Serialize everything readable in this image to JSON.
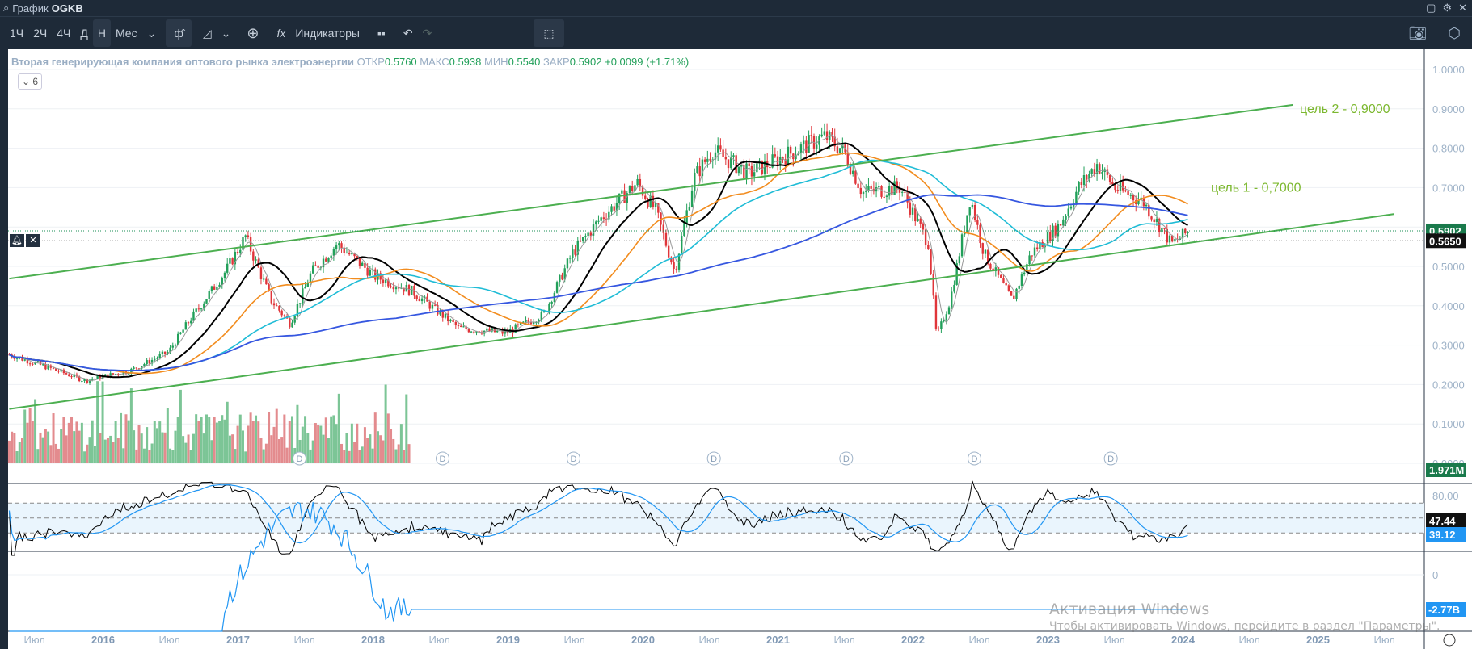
{
  "window": {
    "title_prefix": "График",
    "symbol": "OGKB"
  },
  "toolbar": {
    "intervals": [
      "1Ч",
      "2Ч",
      "4Ч",
      "Д",
      "Н",
      "Мес"
    ],
    "active_interval": "Н",
    "indicators_label": "Индикаторы"
  },
  "legend": {
    "name": "Вторая генерирующая компания оптового рынка электроэнергии",
    "open_label": "ОТКР",
    "open": "0.5760",
    "high_label": "МАКС",
    "high": "0.5938",
    "low_label": "МИН",
    "low": "0.5540",
    "close_label": "ЗАКР",
    "close": "0.5902",
    "change": "+0.0099 (+1.71%)",
    "collapse": "6"
  },
  "colors": {
    "up": "#22a05a",
    "down": "#e0353a",
    "trend": "#4caf50",
    "ma_fast": "#999999",
    "ma20": "#000000",
    "ma50": "#f28c1e",
    "ma100": "#1fbcd6",
    "ma200": "#3657e0",
    "rsi": "#000000",
    "rsi_ma": "#2196f3"
  },
  "annotations": {
    "target2": "цель 2 - 0,9000",
    "target1": "цель 1 - 0,7000"
  },
  "price_axis": {
    "ticks": [
      "1.0000",
      "0.9000",
      "0.8000",
      "0.7000",
      "0.6000",
      "0.5000",
      "0.4000",
      "0.3000",
      "0.2000",
      "0.1000",
      "0.0000"
    ],
    "last_price": "0.5902",
    "alert_price": "0.5650",
    "volume_label": "1.971M"
  },
  "rsi_axis": {
    "tick": "80.00",
    "rsi_value": "47.44",
    "rsi_ma_value": "39.12"
  },
  "lower_axis": {
    "tick": "0",
    "value": "-2.77B"
  },
  "time_axis": [
    "Июл",
    "2016",
    "Июл",
    "2017",
    "Июл",
    "2018",
    "Июл",
    "2019",
    "Июл",
    "2020",
    "Июл",
    "2021",
    "Июл",
    "2022",
    "Июл",
    "2023",
    "Июл",
    "2024",
    "Июл",
    "2025",
    "Июл"
  ],
  "price_keypoints": [
    [
      2015.32,
      0.276
    ],
    [
      2015.67,
      0.236
    ],
    [
      2015.88,
      0.21
    ],
    [
      2016.22,
      0.236
    ],
    [
      2016.5,
      0.283
    ],
    [
      2016.64,
      0.355
    ],
    [
      2016.92,
      0.486
    ],
    [
      2017.07,
      0.576
    ],
    [
      2017.26,
      0.414
    ],
    [
      2017.4,
      0.355
    ],
    [
      2017.56,
      0.486
    ],
    [
      2017.75,
      0.557
    ],
    [
      2018.03,
      0.474
    ],
    [
      2018.3,
      0.438
    ],
    [
      2018.65,
      0.343
    ],
    [
      2019.0,
      0.331
    ],
    [
      2019.28,
      0.379
    ],
    [
      2019.49,
      0.533
    ],
    [
      2019.69,
      0.617
    ],
    [
      2019.97,
      0.712
    ],
    [
      2020.11,
      0.64
    ],
    [
      2020.25,
      0.486
    ],
    [
      2020.39,
      0.724
    ],
    [
      2020.53,
      0.795
    ],
    [
      2020.8,
      0.736
    ],
    [
      2021.08,
      0.783
    ],
    [
      2021.36,
      0.83
    ],
    [
      2021.5,
      0.795
    ],
    [
      2021.64,
      0.688
    ],
    [
      2021.92,
      0.7
    ],
    [
      2022.13,
      0.557
    ],
    [
      2022.19,
      0.319
    ],
    [
      2022.29,
      0.414
    ],
    [
      2022.44,
      0.676
    ],
    [
      2022.54,
      0.533
    ],
    [
      2022.75,
      0.414
    ],
    [
      2022.89,
      0.533
    ],
    [
      2023.1,
      0.605
    ],
    [
      2023.24,
      0.7
    ],
    [
      2023.38,
      0.76
    ],
    [
      2023.51,
      0.7
    ],
    [
      2023.72,
      0.664
    ],
    [
      2023.93,
      0.557
    ],
    [
      2024.06,
      0.59
    ]
  ],
  "trendlines": [
    {
      "name": "upper",
      "from": [
        2015.32,
        0.469
      ],
      "to": [
        2024.83,
        0.91
      ]
    },
    {
      "name": "lower",
      "from": [
        2015.32,
        0.138
      ],
      "to": [
        2025.58,
        0.633
      ]
    }
  ],
  "dividend_marker": "D",
  "dividend_dates": [
    2017.47,
    2018.53,
    2019.5,
    2020.54,
    2021.52,
    2022.47,
    2023.48
  ],
  "watermark": {
    "title": "Активация Windows",
    "text": "Чтобы активировать Windows, перейдите в раздел \"Параметры\"."
  }
}
